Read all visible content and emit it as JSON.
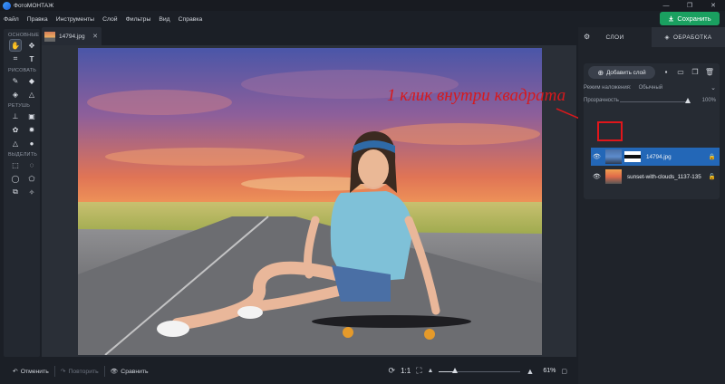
{
  "window": {
    "title": "ФотоМОНТАЖ",
    "minimize": "—",
    "maximize": "❐",
    "close": "✕"
  },
  "menu": [
    "Файл",
    "Правка",
    "Инструменты",
    "Слой",
    "Фильтры",
    "Вид",
    "Справка"
  ],
  "save_button": "Сохранить",
  "tools": {
    "sections": [
      "ОСНОВНЫЕ",
      "РИСОВАТЬ",
      "РЕТУШЬ",
      "ВЫДЕЛИТЬ"
    ]
  },
  "document_tab": {
    "name": "14794.jpg",
    "close": "✕"
  },
  "bottom": {
    "undo": "Отменить",
    "redo": "Повторить",
    "compare": "Сравнить",
    "one_to_one": "1:1",
    "zoom": "61%",
    "zoom_level": 0.2
  },
  "right_panel": {
    "tab_layers": "СЛОИ",
    "tab_processing": "ОБРАБОТКА",
    "add_layer": "Добавить слой",
    "blend_label": "Режим наложения:",
    "blend_value": "Обычный",
    "opacity_label": "Прозрачность",
    "opacity_value": "100%",
    "layers": [
      {
        "name": "14794.jpg",
        "selected": true
      },
      {
        "name": "sunset-with-clouds_1137-135",
        "selected": false
      }
    ]
  },
  "annotation": "1 клик внутри квадрата",
  "colors": {
    "accent_green": "#1aa060",
    "selection_blue": "#2367b7",
    "annotation_red": "#d7191c"
  }
}
